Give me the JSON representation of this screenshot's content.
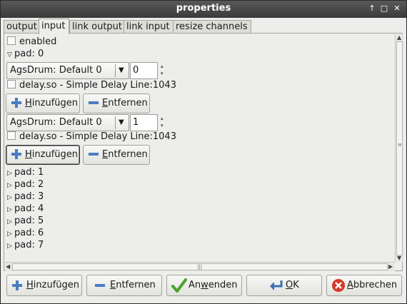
{
  "window": {
    "title": "properties"
  },
  "tabs": [
    {
      "label": "output"
    },
    {
      "label": "input"
    },
    {
      "label": "link output"
    },
    {
      "label": "link input"
    },
    {
      "label": "resize channels"
    }
  ],
  "enabled_label": "enabled",
  "pad0": {
    "label": "pad: 0",
    "channels": [
      {
        "combo": "AgsDrum: Default 0",
        "spin": "0",
        "plugin": "delay.so - Simple Delay Line:1043"
      },
      {
        "combo": "AgsDrum: Default 0",
        "spin": "1",
        "plugin": "delay.so - Simple Delay Line:1043"
      }
    ]
  },
  "buttons": {
    "add_prefix": "",
    "add_mnemonic": "H",
    "add_rest": "inzufügen",
    "remove_mnemonic": "E",
    "remove_rest": "ntfernen"
  },
  "pads": [
    "pad: 1",
    "pad: 2",
    "pad: 3",
    "pad: 4",
    "pad: 5",
    "pad: 6",
    "pad: 7"
  ],
  "footer": {
    "add_mn": "H",
    "add_rest": "inzufügen",
    "remove_mn": "E",
    "remove_rest": "ntfernen",
    "apply_a": "An",
    "apply_mn": "w",
    "apply_b": "enden",
    "ok_mn": "O",
    "ok_rest": "K",
    "cancel_mn": "A",
    "cancel_rest": "bbrechen"
  }
}
